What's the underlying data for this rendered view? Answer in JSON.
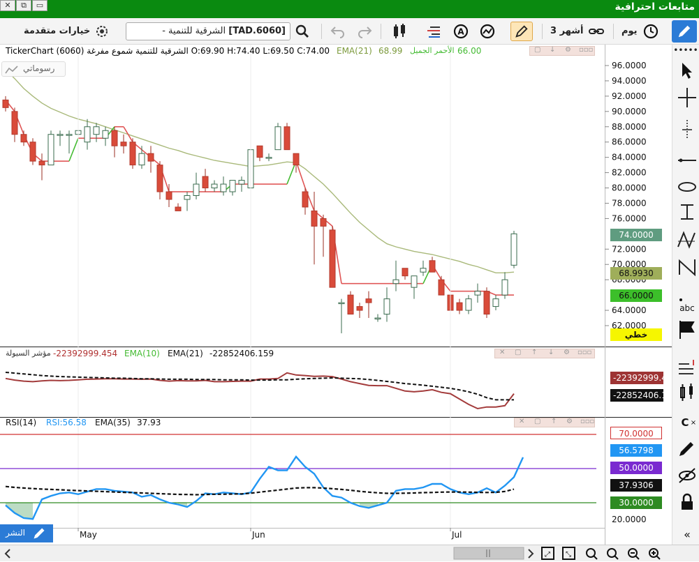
{
  "window": {
    "title": "متابعات احترافية"
  },
  "toolbar": {
    "advanced_options": "خيارات متقدمة",
    "symbol_prefix": "[TAD.6060]",
    "symbol_name": "- الشرقية للتنمية",
    "range": "3 أشهر",
    "interval": "يوم"
  },
  "main_pane": {
    "header_left": "TickerChart الشرقية للتنمية شموع مفرغة (6060) O:69.90 H:74.40 L:69.50 C:74.00",
    "ema_label": "EMA(21)",
    "ema_value": "68.99",
    "red_label": "الأحمر الجميل",
    "red_value": "66.00",
    "drawings_label": "رسوماتي"
  },
  "liquidity_pane": {
    "title": "مؤشر السيولة",
    "value": "-22392999.454",
    "ema10_label": "EMA(10)",
    "ema21_label": "EMA(21)",
    "ema21_value": "-22852406.159",
    "label_red": "-22392999.4",
    "label_black": "-22852406.1"
  },
  "rsi_pane": {
    "rsi_label": "RSI(14)",
    "rsi_value": "RSI:56.58",
    "ema_label": "EMA(35)",
    "ema_value": "37.93",
    "labels": [
      "70.0000",
      "56.5798",
      "50.0000",
      "37.9306",
      "30.0000"
    ],
    "axis_low": "20.0000"
  },
  "price_labels": {
    "close": "74.0000",
    "ema": "68.9930",
    "red": "66.0000",
    "khatti": "خطي"
  },
  "bottom_tag": "النشر",
  "colors": {
    "up": "#2e8b57",
    "down": "#d94b3a",
    "ema": "#a9b97a",
    "red_line": "#e05555",
    "green_line": "#44bb33",
    "rsi": "#2196f3"
  },
  "chart_data": [
    {
      "type": "candlestick",
      "ylim": [
        60,
        97
      ],
      "yticks": [
        "96.0000",
        "94.0000",
        "92.0000",
        "90.0000",
        "88.0000",
        "86.0000",
        "84.0000",
        "82.0000",
        "80.0000",
        "78.0000",
        "76.0000",
        "72.0000",
        "70.0000",
        "68.0000",
        "64.0000",
        "62.0000"
      ],
      "x_labels": [
        "May",
        "Jun",
        "Jul"
      ],
      "x_label_index": [
        8,
        27,
        49
      ],
      "ohlc": [
        [
          91.5,
          92.0,
          90.0,
          90.5
        ],
        [
          90.0,
          90.5,
          86.0,
          87.0
        ],
        [
          87.0,
          87.5,
          85.5,
          86.0
        ],
        [
          86.0,
          86.5,
          83.0,
          83.5
        ],
        [
          83.5,
          84.5,
          81.0,
          83.0
        ],
        [
          83.0,
          87.5,
          83.0,
          87.0
        ],
        [
          87.0,
          87.5,
          85.5,
          87.0
        ],
        [
          87.0,
          87.5,
          84.5,
          87.0
        ],
        [
          87.0,
          88.0,
          86.0,
          87.5
        ],
        [
          86.0,
          89.0,
          85.0,
          88.0
        ],
        [
          87.0,
          88.5,
          86.0,
          88.0
        ],
        [
          86.5,
          88.0,
          85.5,
          87.5
        ],
        [
          87.5,
          88.0,
          84.0,
          85.5
        ],
        [
          86.0,
          87.0,
          84.5,
          85.5
        ],
        [
          86.0,
          86.5,
          82.5,
          83.0
        ],
        [
          83.0,
          85.5,
          82.5,
          84.5
        ],
        [
          84.5,
          85.5,
          82.0,
          83.5
        ],
        [
          83.0,
          83.5,
          78.5,
          79.5
        ],
        [
          79.5,
          80.5,
          77.5,
          78.5
        ],
        [
          77.5,
          78.0,
          77.0,
          77.0
        ],
        [
          78.5,
          79.5,
          77.0,
          79.0
        ],
        [
          79.0,
          82.0,
          78.5,
          80.5
        ],
        [
          81.5,
          82.5,
          79.5,
          80.0
        ],
        [
          80.0,
          81.0,
          79.5,
          80.5
        ],
        [
          79.5,
          81.5,
          79.0,
          80.5
        ],
        [
          79.5,
          81.0,
          79.0,
          81.0
        ],
        [
          80.5,
          81.5,
          79.5,
          81.0
        ],
        [
          80.0,
          86.0,
          80.0,
          85.0
        ],
        [
          85.5,
          85.5,
          83.5,
          84.0
        ],
        [
          84.0,
          84.5,
          83.5,
          84.0
        ],
        [
          85.0,
          88.5,
          85.0,
          88.0
        ],
        [
          88.0,
          88.5,
          85.0,
          85.0
        ],
        [
          84.5,
          84.5,
          82.0,
          83.0
        ],
        [
          79.5,
          80.0,
          76.5,
          77.5
        ],
        [
          77.0,
          79.5,
          70.0,
          75.0
        ],
        [
          76.0,
          76.5,
          71.0,
          75.0
        ],
        [
          74.5,
          75.0,
          67.0,
          67.0
        ],
        [
          65.0,
          65.5,
          61.0,
          65.0
        ],
        [
          66.0,
          66.5,
          63.5,
          63.5
        ],
        [
          64.5,
          65.0,
          63.0,
          64.0
        ],
        [
          65.5,
          66.5,
          63.0,
          65.0
        ],
        [
          63.0,
          63.5,
          62.5,
          63.0
        ],
        [
          63.5,
          67.0,
          62.5,
          65.5
        ],
        [
          67.5,
          70.5,
          66.5,
          68.0
        ],
        [
          69.5,
          69.5,
          68.0,
          68.5
        ],
        [
          67.0,
          68.5,
          65.5,
          68.5
        ],
        [
          69.0,
          70.5,
          68.5,
          69.5
        ],
        [
          70.5,
          71.0,
          69.0,
          69.0
        ],
        [
          68.0,
          68.5,
          66.0,
          66.0
        ],
        [
          66.0,
          66.5,
          64.0,
          64.0
        ],
        [
          65.0,
          65.5,
          63.5,
          64.0
        ],
        [
          64.0,
          66.0,
          63.5,
          65.5
        ],
        [
          66.0,
          67.5,
          65.0,
          66.5
        ],
        [
          66.5,
          67.0,
          63.0,
          63.5
        ],
        [
          64.5,
          66.0,
          64.0,
          65.5
        ],
        [
          66.0,
          69.0,
          65.5,
          68.0
        ],
        [
          69.9,
          74.4,
          69.5,
          74.0
        ]
      ],
      "series": [
        {
          "name": "EMA(21)",
          "values": [
            95.5,
            94.3,
            93.0,
            92.0,
            91.1,
            90.4,
            89.9,
            89.4,
            89.0,
            88.7,
            88.4,
            88.0,
            87.6,
            87.2,
            86.8,
            86.4,
            86.0,
            85.6,
            85.2,
            84.9,
            84.5,
            84.2,
            83.9,
            83.6,
            83.4,
            83.2,
            83.0,
            82.8,
            82.9,
            83.0,
            83.2,
            83.4,
            83.3,
            82.5,
            81.5,
            80.5,
            79.3,
            78.0,
            76.7,
            75.5,
            74.5,
            73.5,
            72.7,
            72.3,
            72.0,
            71.7,
            71.5,
            71.3,
            71.0,
            70.7,
            70.4,
            70.0,
            69.7,
            69.3,
            68.9,
            68.9,
            69.0
          ]
        },
        {
          "name": "الأحمر الجميل",
          "values": [
            91.5,
            90.0,
            87.0,
            84.5,
            83.5,
            83.5,
            83.5,
            83.5,
            86.5,
            86.5,
            86.5,
            86.5,
            88.0,
            88.0,
            86.0,
            85.0,
            84.0,
            83.0,
            79.5,
            79.5,
            79.5,
            79.5,
            79.5,
            79.5,
            79.5,
            80.5,
            80.5,
            80.5,
            80.5,
            80.5,
            80.5,
            80.5,
            83.5,
            80.0,
            77.0,
            76.0,
            75.0,
            67.5,
            67.5,
            67.5,
            67.5,
            67.5,
            67.5,
            67.5,
            67.5,
            67.5,
            67.5,
            70.0,
            68.0,
            66.5,
            66.5,
            66.5,
            66.5,
            66.5,
            66.0,
            66.0,
            66.0
          ]
        }
      ]
    },
    {
      "type": "line",
      "title": "مؤشر السيولة",
      "series": [
        {
          "name": "مؤشر السيولة",
          "values": [
            -7.3,
            -7.9,
            -8.3,
            -8.5,
            -8.2,
            -8.0,
            -8.1,
            -8.0,
            -7.8,
            -7.6,
            -7.5,
            -7.4,
            -7.4,
            -7.5,
            -7.5,
            -7.6,
            -7.5,
            -8.0,
            -8.3,
            -8.1,
            -8.2,
            -8.2,
            -8.0,
            -8.5,
            -8.5,
            -8.4,
            -8.3,
            -8.3,
            -7.5,
            -7.5,
            -7.3,
            -5.2,
            -6.0,
            -6.2,
            -6.5,
            -6.4,
            -6.6,
            -7.5,
            -8.5,
            -9.2,
            -9.9,
            -10.0,
            -10.0,
            -11.0,
            -12.0,
            -12.3,
            -12.0,
            -11.5,
            -12.5,
            -13.0,
            -15.0,
            -17.0,
            -18.6,
            -18.0,
            -18.0,
            -17.5,
            -13.0
          ]
        },
        {
          "name": "EMA(21)",
          "values": [
            -5.0,
            -5.3,
            -5.6,
            -5.9,
            -6.2,
            -6.4,
            -6.6,
            -6.7,
            -6.8,
            -6.9,
            -7.0,
            -7.1,
            -7.2,
            -7.2,
            -7.3,
            -7.4,
            -7.4,
            -7.5,
            -7.6,
            -7.6,
            -7.6,
            -7.7,
            -7.7,
            -7.7,
            -7.8,
            -7.8,
            -7.8,
            -7.9,
            -7.9,
            -7.9,
            -7.8,
            -7.8,
            -7.6,
            -7.4,
            -7.3,
            -7.2,
            -7.1,
            -7.2,
            -7.3,
            -7.4,
            -7.7,
            -8.0,
            -8.4,
            -8.8,
            -9.2,
            -9.5,
            -9.8,
            -10.2,
            -10.6,
            -11.0,
            -11.6,
            -12.3,
            -13.2,
            -14.5,
            -15.3,
            -15.3,
            -15.3
          ]
        }
      ]
    },
    {
      "type": "line",
      "ylim": [
        20,
        80
      ],
      "series": [
        {
          "name": "RSI:56.58",
          "values": [
            28.5,
            24.0,
            21.0,
            20.5,
            32.0,
            34.0,
            35.5,
            36.0,
            35.0,
            36.5,
            38.0,
            38.0,
            37.0,
            36.5,
            36.0,
            33.5,
            34.5,
            32.0,
            30.0,
            29.0,
            27.5,
            31.0,
            35.5,
            35.0,
            36.0,
            35.5,
            35.0,
            36.0,
            44.0,
            51.0,
            49.0,
            49.0,
            57.0,
            51.0,
            47.0,
            39.0,
            34.0,
            33.0,
            30.0,
            28.0,
            27.0,
            28.5,
            30.0,
            37.0,
            38.0,
            38.0,
            39.0,
            41.0,
            41.0,
            38.0,
            36.0,
            35.0,
            36.0,
            38.5,
            36.0,
            40.0,
            45.0,
            56.58
          ]
        },
        {
          "name": "EMA(35)",
          "values": [
            39.5,
            39.0,
            38.6,
            38.3,
            38.0,
            37.8,
            37.6,
            37.3,
            37.1,
            36.9,
            36.7,
            36.5,
            36.3,
            36.1,
            35.9,
            35.7,
            35.5,
            35.3,
            35.1,
            34.9,
            34.8,
            34.7,
            34.8,
            35.0,
            35.0,
            35.1,
            35.2,
            35.6,
            36.2,
            36.8,
            37.4,
            38.0,
            38.6,
            38.8,
            38.8,
            38.6,
            38.2,
            37.8,
            37.3,
            36.7,
            36.2,
            35.8,
            35.5,
            35.5,
            35.6,
            35.7,
            35.9,
            36.0,
            36.2,
            36.3,
            36.3,
            36.2,
            36.1,
            36.0,
            36.1,
            36.6,
            37.93
          ]
        }
      ]
    }
  ]
}
